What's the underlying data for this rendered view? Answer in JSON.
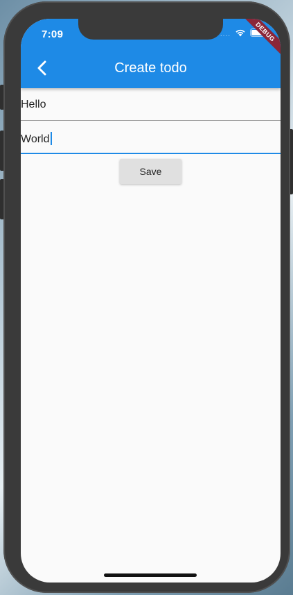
{
  "status_bar": {
    "time": "7:09",
    "signal_icon": "signal-dots-icon",
    "wifi_icon": "wifi-icon",
    "battery_icon": "battery-icon"
  },
  "debug_banner": "DEBUG",
  "app_bar": {
    "title": "Create todo",
    "back_icon": "chevron-left-icon",
    "background_color": "#1e8ae6"
  },
  "form": {
    "title_value": "Hello",
    "description_value": "World",
    "focused_accent_color": "#1e8ae6",
    "save_label": "Save"
  }
}
